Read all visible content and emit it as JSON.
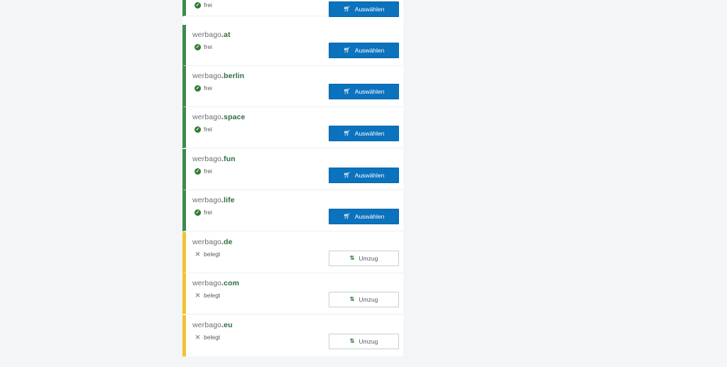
{
  "domains": [
    {
      "sld": "",
      "tld": "",
      "status": "frei",
      "state": "free",
      "action": "Auswählen"
    },
    {
      "sld": "werbago",
      "tld": ".at",
      "status": "frei",
      "state": "free",
      "action": "Auswählen"
    },
    {
      "sld": "werbago",
      "tld": ".berlin",
      "status": "frei",
      "state": "free",
      "action": "Auswählen"
    },
    {
      "sld": "werbago",
      "tld": ".space",
      "status": "frei",
      "state": "free",
      "action": "Auswählen"
    },
    {
      "sld": "werbago",
      "tld": ".fun",
      "status": "frei",
      "state": "free",
      "action": "Auswählen"
    },
    {
      "sld": "werbago",
      "tld": ".life",
      "status": "frei",
      "state": "free",
      "action": "Auswählen"
    },
    {
      "sld": "werbago",
      "tld": ".de",
      "status": "belegt",
      "state": "taken",
      "action": "Umzug"
    },
    {
      "sld": "werbago",
      "tld": ".com",
      "status": "belegt",
      "state": "taken",
      "action": "Umzug"
    },
    {
      "sld": "werbago",
      "tld": ".eu",
      "status": "belegt",
      "state": "taken",
      "action": "Umzug"
    }
  ],
  "colors": {
    "free_accent": "#3c8a4e",
    "taken_accent": "#f1c232",
    "button_primary": "#0b72bd"
  },
  "icons": {
    "free": "check-circle-icon",
    "taken": "cross-icon",
    "select": "cart-icon",
    "move": "transfer-arrows-icon"
  }
}
